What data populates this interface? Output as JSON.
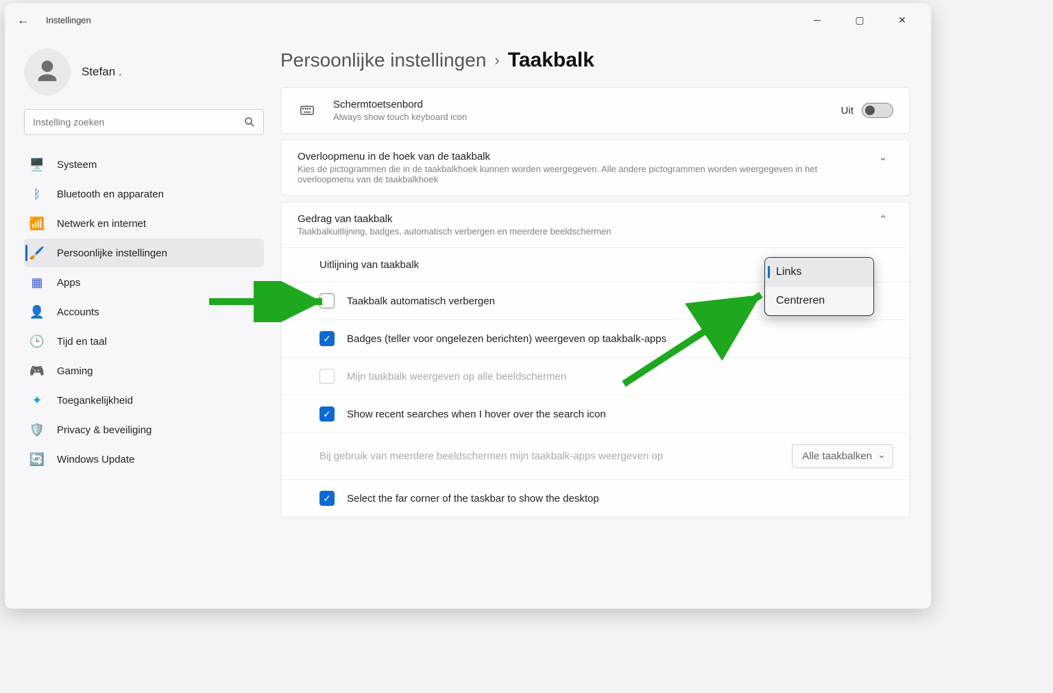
{
  "window": {
    "title": "Instellingen"
  },
  "user": {
    "name": "Stefan ."
  },
  "search": {
    "placeholder": "Instelling zoeken"
  },
  "nav": {
    "items": [
      {
        "label": "Systeem",
        "icon": "monitor-icon",
        "color": "#2d78d4"
      },
      {
        "label": "Bluetooth en apparaten",
        "icon": "bluetooth-icon",
        "color": "#2d78d4"
      },
      {
        "label": "Netwerk en internet",
        "icon": "wifi-icon",
        "color": "#1f9fd6"
      },
      {
        "label": "Persoonlijke instellingen",
        "icon": "paint-icon",
        "color": "#e98a2e",
        "active": true
      },
      {
        "label": "Apps",
        "icon": "apps-icon",
        "color": "#3e5bcf"
      },
      {
        "label": "Accounts",
        "icon": "person-icon",
        "color": "#2fae60"
      },
      {
        "label": "Tijd en taal",
        "icon": "clock-icon",
        "color": "#3db4ac"
      },
      {
        "label": "Gaming",
        "icon": "gamepad-icon",
        "color": "#888"
      },
      {
        "label": "Toegankelijkheid",
        "icon": "accessibility-icon",
        "color": "#1aa2d5"
      },
      {
        "label": "Privacy & beveiliging",
        "icon": "shield-icon",
        "color": "#888"
      },
      {
        "label": "Windows Update",
        "icon": "update-icon",
        "color": "#1f9fd6"
      }
    ]
  },
  "breadcrumb": {
    "parent": "Persoonlijke instellingen",
    "current": "Taakbalk"
  },
  "touchkb": {
    "title": "Schermtoetsenbord",
    "sub": "Always show touch keyboard icon",
    "state": "Uit"
  },
  "overflow": {
    "title": "Overloopmenu in de hoek van de taakbalk",
    "sub": "Kies de pictogrammen die in de taakbalkhoek kunnen worden weergegeven. Alle andere pictogrammen worden weergegeven in het overloopmenu van de taakbalkhoek"
  },
  "behavior": {
    "title": "Gedrag van taakbalk",
    "sub": "Taakbalkuitlijning, badges, automatisch verbergen en meerdere beeldschermen",
    "align_label": "Uitlijning van taakbalk",
    "auto_hide": "Taakbalk automatisch verbergen",
    "badges": "Badges (teller voor ongelezen berichten) weergeven op taakbalk-apps",
    "all_displays": "Mijn taakbalk weergeven op alle beeldschermen",
    "recent_search": "Show recent searches when I hover over the search icon",
    "multi": {
      "label": "Bij gebruik van meerdere beeldschermen mijn taakbalk-apps weergeven op",
      "select": "Alle taakbalken"
    },
    "far_corner": "Select the far corner of the taskbar to show the desktop"
  },
  "dropdown": {
    "selected": "Links",
    "other": "Centreren"
  }
}
